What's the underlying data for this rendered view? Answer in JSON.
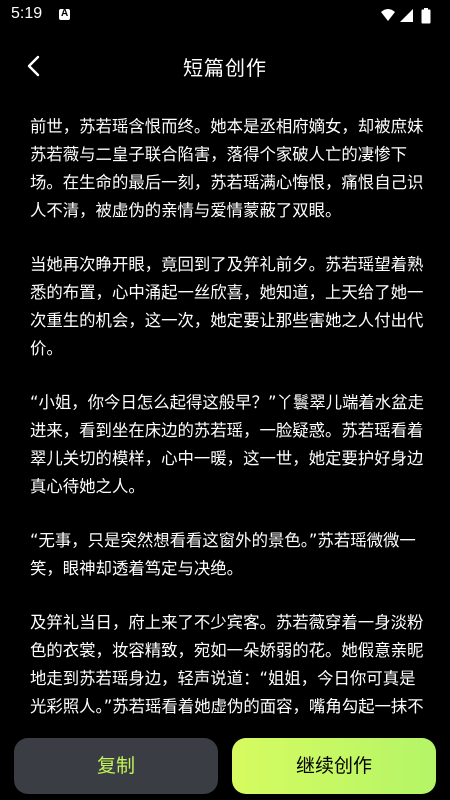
{
  "status_bar": {
    "time": "5:19",
    "icons": [
      "android-a-icon",
      "wifi-icon",
      "signal-icon",
      "battery-icon"
    ]
  },
  "header": {
    "title": "短篇创作",
    "back_icon": "chevron-left-icon"
  },
  "story": {
    "paragraphs": [
      "前世，苏若瑶含恨而终。她本是丞相府嫡女，却被庶妹苏若薇与二皇子联合陷害，落得个家破人亡的凄惨下场。在生命的最后一刻，苏若瑶满心悔恨，痛恨自己识人不清，被虚伪的亲情与爱情蒙蔽了双眼。",
      "当她再次睁开眼，竟回到了及笄礼前夕。苏若瑶望着熟悉的布置，心中涌起一丝欣喜，她知道，上天给了她一次重生的机会，这一次，她定要让那些害她之人付出代价。",
      "“小姐，你今日怎么起得这般早？”丫鬟翠儿端着水盆走进来，看到坐在床边的苏若瑶，一脸疑惑。苏若瑶看着翠儿关切的模样，心中一暖，这一世，她定要护好身边真心待她之人。",
      "“无事，只是突然想看看这窗外的景色。”苏若瑶微微一笑，眼神却透着笃定与决绝。",
      "及笄礼当日，府上来了不少宾客。苏若薇穿着一身淡粉色的衣裳，妆容精致，宛如一朵娇弱的花。她假意亲昵地走到苏若瑶身边，轻声说道：“姐姐，今日你可真是光彩照人。”苏若瑶看着她虚伪的面容，嘴角勾起一抹不易察觉的冷笑，轻声回"
    ]
  },
  "actions": {
    "copy_label": "复制",
    "continue_label": "继续创作"
  },
  "colors": {
    "background": "#000000",
    "accent_green": "#c4f35a",
    "copy_button_bg": "#3a3d44"
  }
}
